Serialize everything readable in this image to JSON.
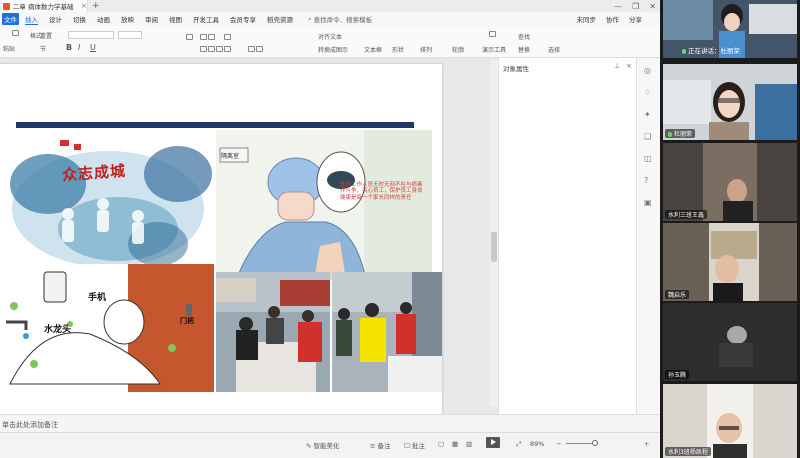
{
  "titlebar": {
    "doc_tab": "二章 病体数力学基础",
    "close": "×",
    "new_tab": "+",
    "controls": [
      "—",
      "❐",
      "✕"
    ]
  },
  "menubar": {
    "file": "文件",
    "items": [
      "插入",
      "设计",
      "切换",
      "动画",
      "放映",
      "审阅",
      "视图",
      "开发工具",
      "会员专享",
      "稻壳资源"
    ],
    "active": "插入",
    "search": "查找命令、搜索模板",
    "right": [
      "未同步",
      "协作",
      "分享"
    ]
  },
  "toolbar": {
    "paste": "粘贴",
    "format_painter": "格式",
    "reset": "重置",
    "section": "节",
    "bold": "B",
    "italic": "I",
    "underline": "U",
    "align": "对齐文本",
    "smartart": "转换成图示",
    "textbox": "文本框",
    "shape": "形状",
    "arrange": "排列",
    "outline": "轮廓",
    "slideshow": "演示工具",
    "find": "查找",
    "replace": "替换",
    "select": "选择"
  },
  "slide": {
    "title_calligraphy": "众志成城",
    "door_sign": "隔离室",
    "speech_text": "医护工作人员无时无刻不在与病毒作斗争，关心员工，保护员工身体健康是每一个家长同样的责任",
    "label_phone": "手机",
    "label_tap": "水龙头",
    "label_door": "门把",
    "accent": "#1e3a66"
  },
  "side_panel": {
    "title": "对象属性"
  },
  "notes": {
    "placeholder": "单击此处添加备注"
  },
  "statusbar": {
    "beautify": "智能美化",
    "notes_btn": "备注",
    "comment_btn": "批注",
    "zoom": "89%"
  },
  "meeting": {
    "sharing_label": "正在讲话：杜丽荣",
    "participants": [
      "杜丽荣",
      "水利三班王鑫",
      "魏启乐",
      "孙玉腾",
      "水利3班杨凯程"
    ]
  }
}
